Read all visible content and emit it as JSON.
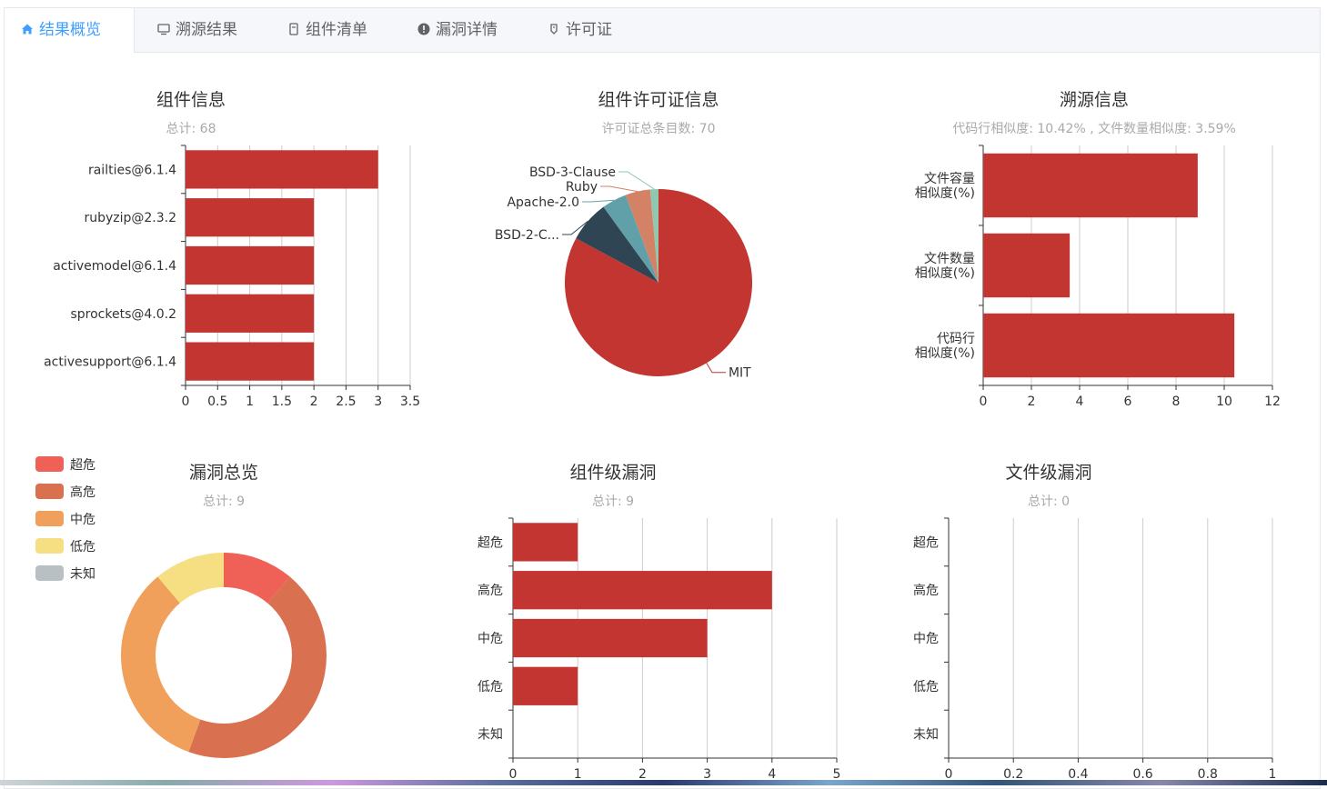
{
  "tabs": [
    {
      "label": "结果概览",
      "icon": "home-icon",
      "active": true
    },
    {
      "label": "溯源结果",
      "icon": "monitor-icon"
    },
    {
      "label": "组件清单",
      "icon": "document-icon"
    },
    {
      "label": "漏洞详情",
      "icon": "alert-circle-icon"
    },
    {
      "label": "许可证",
      "icon": "stamp-icon"
    }
  ],
  "colors": {
    "bar": "#c23531",
    "accent": "#409eff"
  },
  "chart_data": [
    {
      "type": "bar",
      "orientation": "horizontal",
      "title": "组件信息",
      "subtitle": "总计:   68",
      "categories": [
        "railties@6.1.4",
        "rubyzip@2.3.2",
        "activemodel@6.1.4",
        "sprockets@4.0.2",
        "activesupport@6.1.4"
      ],
      "values": [
        3,
        2,
        2,
        2,
        2
      ],
      "xlim": [
        0,
        3.5
      ],
      "xticks": [
        "0",
        "0.5",
        "1",
        "1.5",
        "2",
        "2.5",
        "3",
        "3.5"
      ],
      "grid": true
    },
    {
      "type": "pie",
      "title": "组件许可证信息",
      "subtitle": "许可证总条目数: 70",
      "slices": [
        {
          "label": "MIT",
          "value": 58,
          "color": "#c23531"
        },
        {
          "label": "BSD-2-C...",
          "value": 5,
          "color": "#2f4554"
        },
        {
          "label": "Apache-2.0",
          "value": 3,
          "color": "#61a0a8"
        },
        {
          "label": "Ruby",
          "value": 3,
          "color": "#d48265"
        },
        {
          "label": "BSD-3-Clause",
          "value": 1,
          "color": "#91c7ae"
        }
      ]
    },
    {
      "type": "bar",
      "orientation": "horizontal",
      "title": "溯源信息",
      "subtitle": "代码行相似度: 10.42% , 文件数量相似度: 3.59%",
      "categories": [
        [
          "文件容量",
          "相似度(%)"
        ],
        [
          "文件数量",
          "相似度(%)"
        ],
        [
          "代码行",
          "相似度(%)"
        ]
      ],
      "values": [
        8.9,
        3.59,
        10.42
      ],
      "xlim": [
        0,
        12
      ],
      "xticks": [
        "0",
        "2",
        "4",
        "6",
        "8",
        "10",
        "12"
      ],
      "grid": true
    },
    {
      "type": "pie",
      "variant": "donut",
      "title": "漏洞总览",
      "subtitle": "总计:   9",
      "legend": "top-left",
      "slices": [
        {
          "label": "超危",
          "value": 1,
          "color": "#ef6057"
        },
        {
          "label": "高危",
          "value": 4,
          "color": "#d97050"
        },
        {
          "label": "中危",
          "value": 3,
          "color": "#f0a05a"
        },
        {
          "label": "低危",
          "value": 1,
          "color": "#f6df83"
        },
        {
          "label": "未知",
          "value": 0,
          "color": "#b8c0c4"
        }
      ]
    },
    {
      "type": "bar",
      "orientation": "horizontal",
      "title": "组件级漏洞",
      "subtitle": "总计:   9",
      "categories": [
        "超危",
        "高危",
        "中危",
        "低危",
        "未知"
      ],
      "values": [
        1,
        4,
        3,
        1,
        0
      ],
      "xlim": [
        0,
        5
      ],
      "xticks": [
        "0",
        "1",
        "2",
        "3",
        "4",
        "5"
      ],
      "grid": true
    },
    {
      "type": "bar",
      "orientation": "horizontal",
      "title": "文件级漏洞",
      "subtitle": "总计:   0",
      "categories": [
        "超危",
        "高危",
        "中危",
        "低危",
        "未知"
      ],
      "values": [
        0,
        0,
        0,
        0,
        0
      ],
      "xlim": [
        0,
        1
      ],
      "xticks": [
        "0",
        "0.2",
        "0.4",
        "0.6",
        "0.8",
        "1"
      ],
      "grid": true
    }
  ]
}
